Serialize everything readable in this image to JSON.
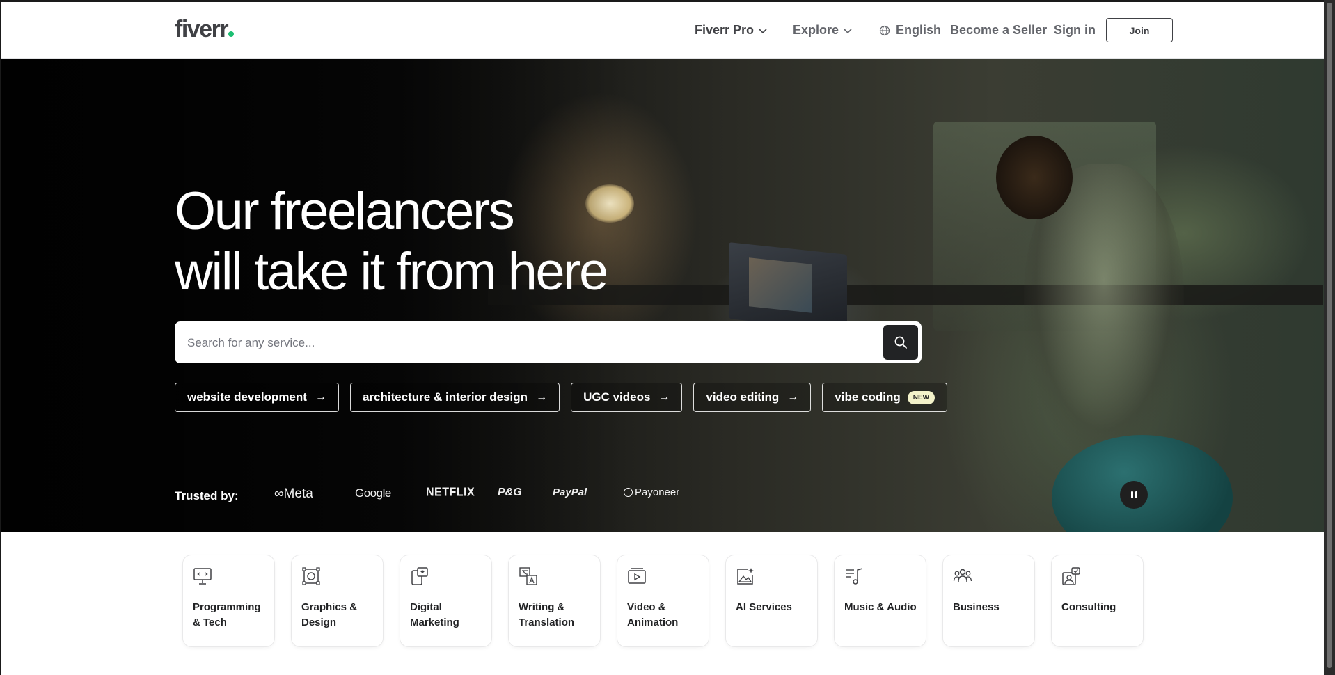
{
  "header": {
    "logo": "fiverr",
    "fiverr_pro": "Fiverr Pro",
    "explore": "Explore",
    "language": "English",
    "become_seller": "Become a Seller",
    "sign_in": "Sign in",
    "join": "Join"
  },
  "hero": {
    "title_line1": "Our freelancers",
    "title_line2": "will take it from here",
    "search": {
      "placeholder": "Search for any service...",
      "value": ""
    },
    "chips": [
      {
        "label": "website development",
        "icon": "arrow-right-icon"
      },
      {
        "label": "architecture & interior design",
        "icon": "arrow-right-icon"
      },
      {
        "label": "UGC videos",
        "icon": "arrow-right-icon"
      },
      {
        "label": "video editing",
        "icon": "arrow-right-icon"
      },
      {
        "label": "vibe coding",
        "badge": "NEW"
      }
    ],
    "trusted_by": "Trusted by:",
    "brands": [
      "Meta",
      "Google",
      "NETFLIX",
      "P&G",
      "PayPal",
      "Payoneer"
    ]
  },
  "categories": [
    {
      "label": "Programming & Tech",
      "icon": "monitor-code-icon"
    },
    {
      "label": "Graphics & Design",
      "icon": "vector-design-icon"
    },
    {
      "label": "Digital Marketing",
      "icon": "marketing-device-icon"
    },
    {
      "label": "Writing & Translation",
      "icon": "translation-icon"
    },
    {
      "label": "Video & Animation",
      "icon": "video-play-icon"
    },
    {
      "label": "AI Services",
      "icon": "ai-image-icon"
    },
    {
      "label": "Music & Audio",
      "icon": "music-note-icon"
    },
    {
      "label": "Business",
      "icon": "people-icon"
    },
    {
      "label": "Consulting",
      "icon": "consulting-icon"
    }
  ],
  "colors": {
    "brand_green": "#1dbf73",
    "text_dark": "#404145",
    "search_button": "#222325",
    "new_badge": "#f3f2c9"
  }
}
